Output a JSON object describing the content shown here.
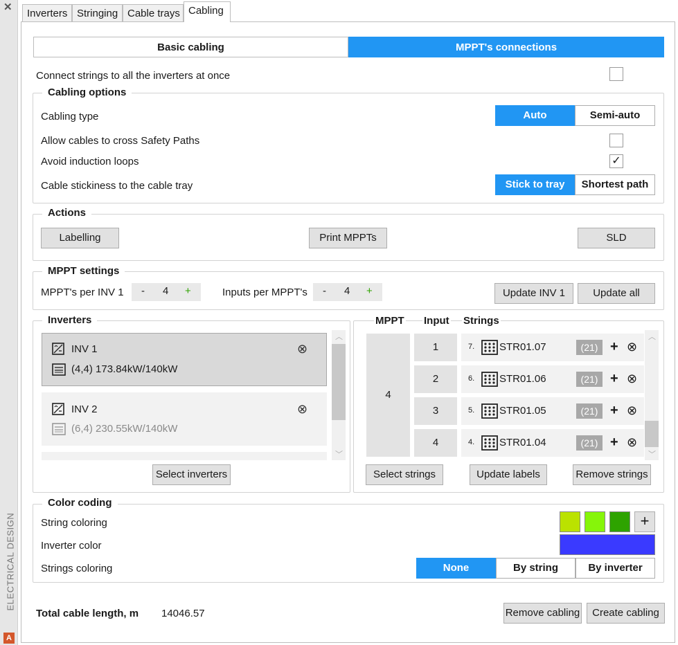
{
  "sidebar": {
    "close": "✕",
    "label": "ELECTRICAL DESIGN",
    "logo": "A"
  },
  "tabs": [
    "Inverters",
    "Stringing",
    "Cable trays",
    "Cabling"
  ],
  "mode": {
    "basic": "Basic cabling",
    "mppt": "MPPT's connections"
  },
  "connect_all": {
    "label": "Connect strings to all the inverters at once",
    "checked": false
  },
  "cabling_options": {
    "title": "Cabling options",
    "type_label": "Cabling type",
    "type_auto": "Auto",
    "type_semi": "Semi-auto",
    "cross_label": "Allow cables to cross Safety Paths",
    "cross_checked": false,
    "loops_label": "Avoid induction loops",
    "loops_checked": true,
    "check_mark": "✓",
    "stick_label": "Cable stickiness to the cable tray",
    "stick_tray": "Stick to tray",
    "stick_short": "Shortest path"
  },
  "actions": {
    "title": "Actions",
    "labelling": "Labelling",
    "print": "Print MPPTs",
    "sld": "SLD"
  },
  "mppt_settings": {
    "title": "MPPT settings",
    "per_inv_label": "MPPT's per INV 1",
    "per_inv_value": "4",
    "inputs_label": "Inputs per MPPT's",
    "inputs_value": "4",
    "minus": "-",
    "plus": "+",
    "update_inv": "Update INV 1",
    "update_all": "Update all"
  },
  "inverters": {
    "title": "Inverters",
    "items": [
      {
        "name": "INV 1",
        "detail": "(4,4)  173.84kW/140kW"
      },
      {
        "name": "INV 2",
        "detail": "(6,4)  230.55kW/140kW"
      }
    ],
    "remove": "⊗",
    "select": "Select inverters"
  },
  "mppt_table": {
    "headers": {
      "mppt": "MPPT",
      "input": "Input",
      "strings": "Strings"
    },
    "mppt_value": "4",
    "rows": [
      {
        "input": "1",
        "num": "7.",
        "name": "STR01.07",
        "count": "(21)"
      },
      {
        "input": "2",
        "num": "6.",
        "name": "STR01.06",
        "count": "(21)"
      },
      {
        "input": "3",
        "num": "5.",
        "name": "STR01.05",
        "count": "(21)"
      },
      {
        "input": "4",
        "num": "4.",
        "name": "STR01.04",
        "count": "(21)"
      }
    ],
    "add": "+",
    "remove": "⊗",
    "select": "Select strings",
    "update": "Update labels",
    "remove_strings": "Remove strings"
  },
  "color_coding": {
    "title": "Color coding",
    "string_label": "String coloring",
    "string_colors": [
      "#bbe200",
      "#86f50a",
      "#2ea300"
    ],
    "add": "+",
    "inverter_label": "Inverter color",
    "inverter_color": "#3a3aff",
    "coloring_label": "Strings coloring",
    "none": "None",
    "by_string": "By string",
    "by_inverter": "By inverter"
  },
  "footer": {
    "total_label": "Total cable length, m",
    "total_value": "14046.57",
    "remove": "Remove cabling",
    "create": "Create cabling"
  },
  "accent": "#2196f3"
}
